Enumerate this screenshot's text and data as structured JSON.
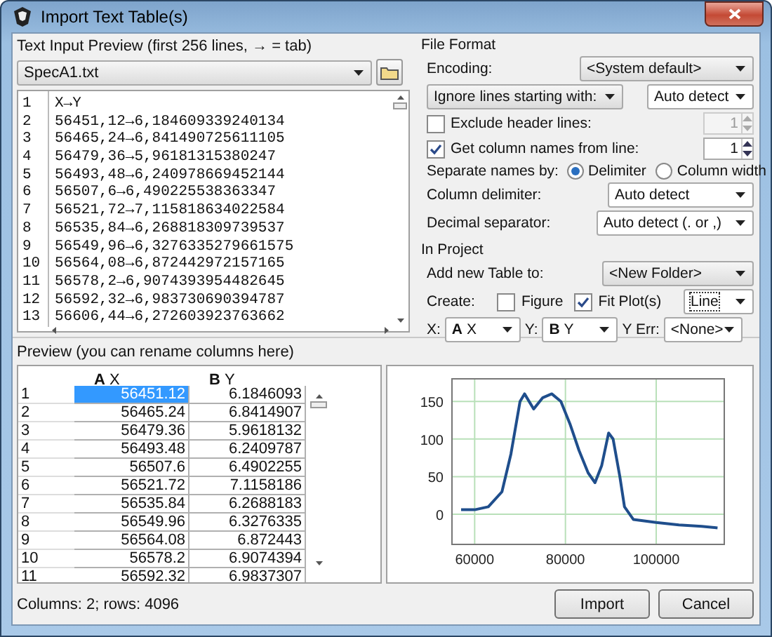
{
  "window": {
    "title": "Import Text Table(s)"
  },
  "text_input": {
    "heading": "Text Input Preview (first 256 lines, → = tab)",
    "file": "SpecA1.txt",
    "lines": [
      {
        "number": "1",
        "text": "X→Y"
      },
      {
        "number": "2",
        "text": "56451,12→6,184609339240134"
      },
      {
        "number": "3",
        "text": "56465,24→6,841490725611105"
      },
      {
        "number": "4",
        "text": "56479,36→5,96181315380247"
      },
      {
        "number": "5",
        "text": "56493,48→6,240978669452144"
      },
      {
        "number": "6",
        "text": "56507,6→6,490225538363347"
      },
      {
        "number": "7",
        "text": "56521,72→7,115818634022584"
      },
      {
        "number": "8",
        "text": "56535,84→6,268818309739537"
      },
      {
        "number": "9",
        "text": "56549,96→6,3276335279661575"
      },
      {
        "number": "10",
        "text": "56564,08→6,872442972157165"
      },
      {
        "number": "11",
        "text": "56578,2→6,9074393954482645"
      },
      {
        "number": "12",
        "text": "56592,32→6,983730690394787"
      },
      {
        "number": "13",
        "text": "56606,44→6,272603923763662"
      }
    ]
  },
  "file_format": {
    "heading": "File Format",
    "encoding_label": "Encoding:",
    "encoding": "<System default>",
    "ignore_mode": "Ignore lines starting with:",
    "ignore_value": "Auto detect",
    "exclude_header": {
      "label": "Exclude header lines:",
      "checked": false,
      "value": "1",
      "disabled": true
    },
    "column_names": {
      "label": "Get column names from line:",
      "checked": true,
      "value": "1",
      "disabled": false
    },
    "separate_label": "Separate names by:",
    "separate_options": [
      {
        "label": "Delimiter",
        "selected": true
      },
      {
        "label": "Column width",
        "selected": false
      }
    ],
    "delimiter_label": "Column delimiter:",
    "delimiter": "Auto detect",
    "decimal_label": "Decimal separator:",
    "decimal": "Auto detect (. or ,)"
  },
  "in_project": {
    "heading": "In Project",
    "add_label": "Add new Table to:",
    "add_value": "<New Folder>",
    "create_label": "Create:",
    "create_options": [
      {
        "label": "Figure",
        "checked": false
      },
      {
        "label": "Fit Plot(s)",
        "checked": true
      }
    ],
    "plot_type": "Line",
    "x_label": "X:",
    "x_value": {
      "letter": "A",
      "name": "X"
    },
    "y_label": "Y:",
    "y_value": {
      "letter": "B",
      "name": "Y"
    },
    "yerr_label": "Y Err:",
    "yerr_value": "<None>"
  },
  "preview": {
    "heading": "Preview (you can rename columns here)",
    "columns": [
      {
        "letter": "A",
        "name": "X"
      },
      {
        "letter": "B",
        "name": "Y"
      }
    ],
    "rows": [
      {
        "number": "1",
        "cells": [
          {
            "value": "56451.12",
            "selected": true
          },
          {
            "value": "6.1846093",
            "selected": false
          }
        ]
      },
      {
        "number": "2",
        "cells": [
          {
            "value": "56465.24",
            "selected": false
          },
          {
            "value": "6.8414907",
            "selected": false
          }
        ]
      },
      {
        "number": "3",
        "cells": [
          {
            "value": "56479.36",
            "selected": false
          },
          {
            "value": "5.9618132",
            "selected": false
          }
        ]
      },
      {
        "number": "4",
        "cells": [
          {
            "value": "56493.48",
            "selected": false
          },
          {
            "value": "6.2409787",
            "selected": false
          }
        ]
      },
      {
        "number": "5",
        "cells": [
          {
            "value": "56507.6",
            "selected": false
          },
          {
            "value": "6.4902255",
            "selected": false
          }
        ]
      },
      {
        "number": "6",
        "cells": [
          {
            "value": "56521.72",
            "selected": false
          },
          {
            "value": "7.1158186",
            "selected": false
          }
        ]
      },
      {
        "number": "7",
        "cells": [
          {
            "value": "56535.84",
            "selected": false
          },
          {
            "value": "6.2688183",
            "selected": false
          }
        ]
      },
      {
        "number": "8",
        "cells": [
          {
            "value": "56549.96",
            "selected": false
          },
          {
            "value": "6.3276335",
            "selected": false
          }
        ]
      },
      {
        "number": "9",
        "cells": [
          {
            "value": "56564.08",
            "selected": false
          },
          {
            "value": "6.872443",
            "selected": false
          }
        ]
      },
      {
        "number": "10",
        "cells": [
          {
            "value": "56578.2",
            "selected": false
          },
          {
            "value": "6.9074394",
            "selected": false
          }
        ]
      },
      {
        "number": "11",
        "cells": [
          {
            "value": "56592.32",
            "selected": false
          },
          {
            "value": "6.9837307",
            "selected": false
          }
        ]
      }
    ]
  },
  "plot": {
    "chart_data": {
      "type": "line",
      "xlim": [
        55000,
        115000
      ],
      "ylim": [
        -40,
        180
      ],
      "xticks": [
        60000,
        80000,
        100000
      ],
      "yticks": [
        0,
        50,
        100,
        150
      ],
      "x": [
        57000,
        60000,
        63000,
        66000,
        68000,
        70000,
        71000,
        73000,
        75000,
        77000,
        79000,
        81000,
        83000,
        85000,
        86500,
        88000,
        89500,
        90500,
        92000,
        93000,
        95000,
        100000,
        105000,
        110000,
        113500
      ],
      "grid": true,
      "series": [
        {
          "color": "#1f4e8c",
          "values": [
            6,
            6,
            10,
            30,
            80,
            150,
            160,
            140,
            155,
            160,
            150,
            120,
            85,
            55,
            42,
            65,
            108,
            100,
            50,
            10,
            -7,
            -11,
            -14,
            -16,
            -18
          ]
        }
      ]
    }
  },
  "status": "Columns: 2; rows: 4096",
  "buttons": [
    "Import",
    "Cancel"
  ]
}
